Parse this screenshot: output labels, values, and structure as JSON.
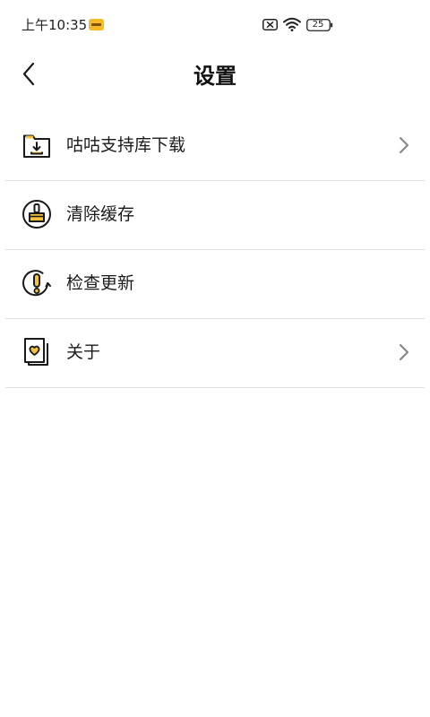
{
  "status_bar": {
    "time": "上午10:35",
    "battery_level": "25"
  },
  "header": {
    "title": "设置",
    "back_icon": "chevron-left-icon"
  },
  "settings": [
    {
      "label": "咕咕支持库下载",
      "icon": "folder-download-icon",
      "has_chevron": true
    },
    {
      "label": "清除缓存",
      "icon": "broom-icon",
      "has_chevron": false
    },
    {
      "label": "检查更新",
      "icon": "update-alert-icon",
      "has_chevron": false
    },
    {
      "label": "关于",
      "icon": "heart-card-icon",
      "has_chevron": true
    }
  ],
  "colors": {
    "accent": "#f6c33a",
    "icon_stroke": "#1a1a1a",
    "chevron": "#888888",
    "divider": "#e0e0e0"
  }
}
